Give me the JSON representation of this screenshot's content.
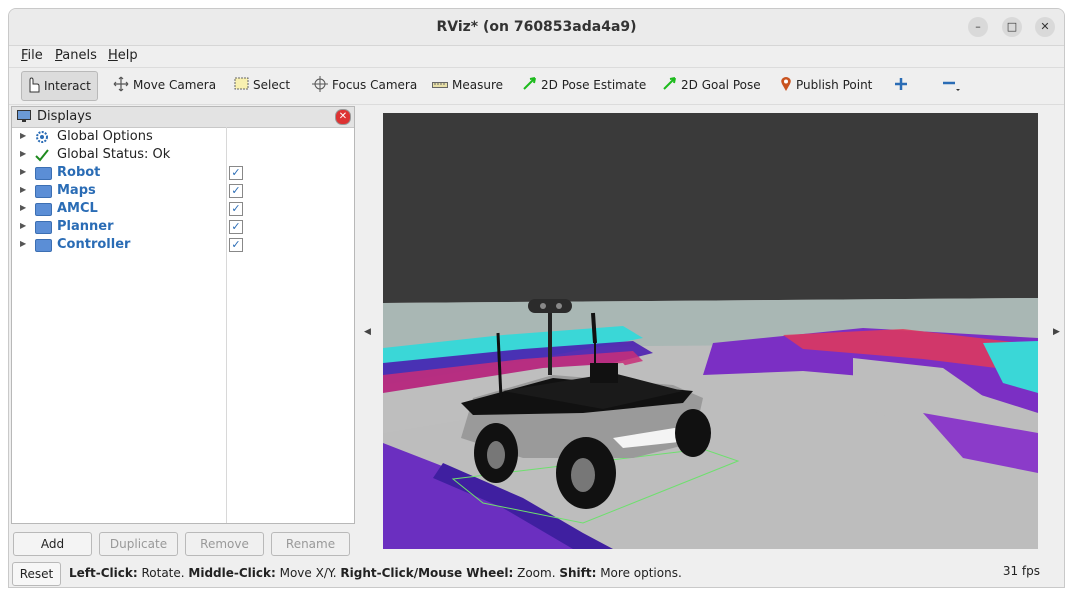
{
  "window": {
    "title": "RViz* (on 760853ada4a9)",
    "controls": {
      "minimize": "–",
      "maximize": "□",
      "close": "✕"
    }
  },
  "menubar": {
    "items": [
      {
        "label": "File",
        "mnemonic": "F",
        "rest": "ile"
      },
      {
        "label": "Panels",
        "mnemonic": "P",
        "rest": "anels"
      },
      {
        "label": "Help",
        "mnemonic": "H",
        "rest": "elp"
      }
    ]
  },
  "toolbar": {
    "tools": [
      {
        "label": "Interact",
        "icon": "hand-icon",
        "active": true
      },
      {
        "label": "Move Camera",
        "icon": "move-icon"
      },
      {
        "label": "Select",
        "icon": "select-box-icon"
      },
      {
        "label": "Focus Camera",
        "icon": "focus-icon"
      },
      {
        "label": "Measure",
        "icon": "ruler-icon"
      },
      {
        "label": "2D Pose Estimate",
        "icon": "green-arrow-icon"
      },
      {
        "label": "2D Goal Pose",
        "icon": "green-arrow-icon"
      },
      {
        "label": "Publish Point",
        "icon": "map-pin-icon"
      }
    ],
    "add_icon": "plus-icon",
    "remove_icon": "minus-icon"
  },
  "displays": {
    "title": "Displays",
    "items": [
      {
        "label": "Global Options",
        "icon": "gear-icon",
        "checkbox": false,
        "bold": false
      },
      {
        "label": "Global Status: Ok",
        "icon": "checkmark-icon",
        "checkbox": false,
        "bold": false
      },
      {
        "label": "Robot",
        "icon": "folder-icon",
        "checkbox": true,
        "checked": true,
        "bold": true
      },
      {
        "label": "Maps",
        "icon": "folder-icon",
        "checkbox": true,
        "checked": true,
        "bold": true
      },
      {
        "label": "AMCL",
        "icon": "folder-icon",
        "checkbox": true,
        "checked": true,
        "bold": true
      },
      {
        "label": "Planner",
        "icon": "folder-icon",
        "checkbox": true,
        "checked": true,
        "bold": true
      },
      {
        "label": "Controller",
        "icon": "folder-icon",
        "checkbox": true,
        "checked": true,
        "bold": true
      }
    ],
    "buttons": {
      "add": "Add",
      "duplicate": "Duplicate",
      "remove": "Remove",
      "rename": "Rename"
    }
  },
  "status": {
    "reset": "Reset",
    "hint": [
      {
        "key": "Left-Click:",
        "desc": " Rotate. "
      },
      {
        "key": "Middle-Click:",
        "desc": " Move X/Y. "
      },
      {
        "key": "Right-Click/Mouse Wheel:",
        "desc": " Zoom. "
      },
      {
        "key": "Shift:",
        "desc": " More options."
      }
    ],
    "fps": "31 fps"
  }
}
